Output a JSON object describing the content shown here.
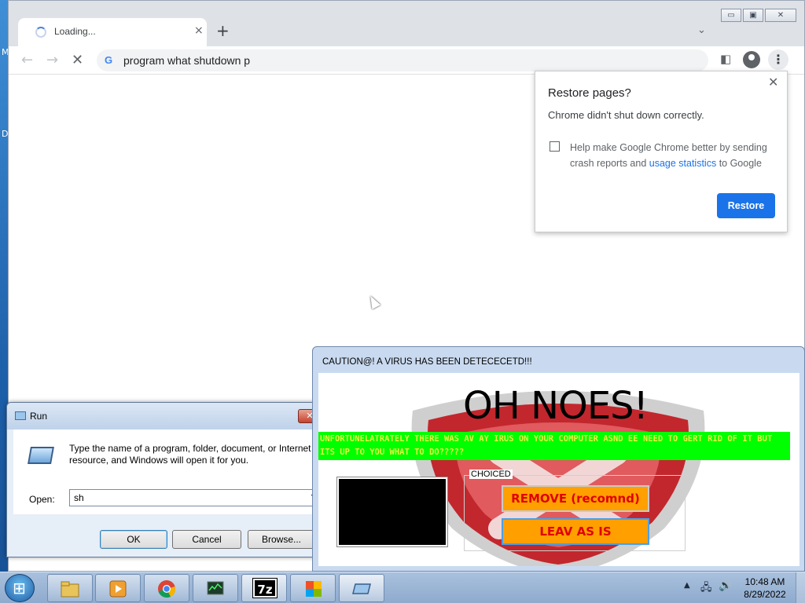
{
  "desktop": {
    "edge_letters": [
      "M",
      "D"
    ]
  },
  "chrome": {
    "tab": {
      "title": "Loading...",
      "close": "×"
    },
    "new_tab": "+",
    "tab_search": "⌄",
    "window_buttons": [
      "▭",
      "▣",
      "✕"
    ],
    "nav": {
      "back": "←",
      "forward": "→",
      "stop": "✕"
    },
    "omnibox": {
      "engine_icon": "G",
      "text": "program what shutdown p"
    },
    "toolbar_icons": [
      "side-panel-icon",
      "profile-icon",
      "menu-icon"
    ],
    "menu_glyph": "⋮",
    "side_panel_glyph": "◧"
  },
  "restore_bubble": {
    "title": "Restore pages?",
    "message": "Chrome didn't shut down correctly.",
    "help_prefix": "Help make Google Chrome better by sending crash reports and ",
    "help_link": "usage statistics",
    "help_suffix": " to Google",
    "button": "Restore",
    "close": "✕"
  },
  "run_dialog": {
    "title": "Run",
    "close": "✕",
    "description": "Type the name of a program, folder, document, or Internet resource, and Windows will open it for you.",
    "open_label": "Open:",
    "open_value": "sh",
    "dropdown": "▼",
    "buttons": {
      "ok": "OK",
      "cancel": "Cancel",
      "browse": "Browse..."
    }
  },
  "virus_window": {
    "title": "CAUTION@! A VIRUS HAS BEEN DETECECETD!!!",
    "headline": "OH NOES!",
    "banner": "UNFORTUNELATRATELY THERE WAS AV AY IRUS ON YOUR COMPUTER ASND EE NEED TO GERT RID OF IT BUT ITS UP TO YOU WHAT TO DO?????",
    "group_label": "CHOICED",
    "remove_button": "REMOVE (recomnd)",
    "leave_button": "LEAV AS IS",
    "colors": {
      "banner_bg": "#00ff00",
      "banner_text": "#e9f43e",
      "button_bg": "#ff9f00",
      "button_text": "#e00000"
    }
  },
  "taskbar": {
    "items": [
      "explorer-icon",
      "media-player-icon",
      "chrome-icon",
      "task-manager-icon",
      "7zip-icon",
      "office-icon",
      "run-icon"
    ],
    "seven_zip_label": "7z",
    "tray": {
      "up": "▲",
      "network": "🖧",
      "volume": "🔊"
    },
    "time": "10:48 AM",
    "date": "8/29/2022"
  }
}
